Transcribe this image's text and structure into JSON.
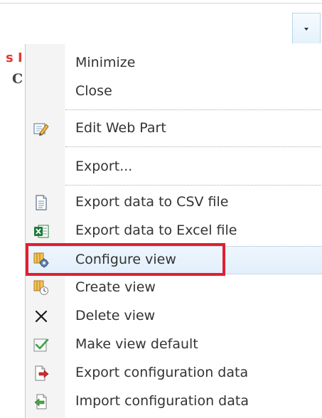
{
  "background": {
    "fragment_red": "s I",
    "fragment_dark": "C"
  },
  "menu": {
    "items": [
      {
        "label": "Minimize",
        "icon": ""
      },
      {
        "label": "Close",
        "icon": ""
      },
      {
        "label": "Edit Web Part",
        "icon": "edit-webpart-icon"
      },
      {
        "label": "Export...",
        "icon": ""
      },
      {
        "label": "Export data to CSV file",
        "icon": "csv-document-icon"
      },
      {
        "label": "Export data to Excel file",
        "icon": "excel-icon"
      },
      {
        "label": "Configure view",
        "icon": "configure-view-icon",
        "highlighted": true
      },
      {
        "label": "Create view",
        "icon": "create-view-icon"
      },
      {
        "label": "Delete view",
        "icon": "delete-x-icon"
      },
      {
        "label": "Make view default",
        "icon": "make-default-checkmark-icon"
      },
      {
        "label": "Export configuration data",
        "icon": "export-configuration-icon"
      },
      {
        "label": "Import configuration data",
        "icon": "import-configuration-icon"
      }
    ]
  },
  "colors": {
    "highlight_border": "#e01f2f",
    "hover_background": "#e8f2fc",
    "excel_green": "#1e7a3a"
  }
}
